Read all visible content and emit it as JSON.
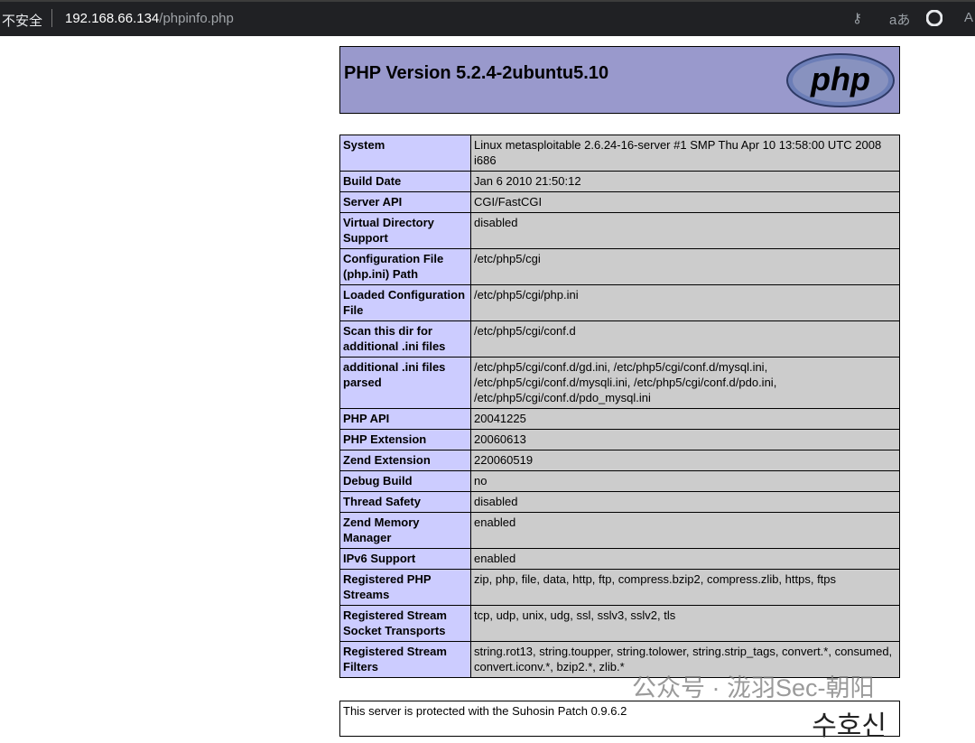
{
  "browser": {
    "security_label": "不安全",
    "url_host": "192.168.66.134",
    "url_path": "/phpinfo.php"
  },
  "header": {
    "title": "PHP Version 5.2.4-2ubuntu5.10",
    "logo_text": "php"
  },
  "rows": [
    {
      "key": "System",
      "value": "Linux metasploitable 2.6.24-16-server #1 SMP Thu Apr 10 13:58:00 UTC 2008 i686"
    },
    {
      "key": "Build Date",
      "value": "Jan 6 2010 21:50:12"
    },
    {
      "key": "Server API",
      "value": "CGI/FastCGI"
    },
    {
      "key": "Virtual Directory Support",
      "value": "disabled"
    },
    {
      "key": "Configuration File (php.ini) Path",
      "value": "/etc/php5/cgi"
    },
    {
      "key": "Loaded Configuration File",
      "value": "/etc/php5/cgi/php.ini"
    },
    {
      "key": "Scan this dir for additional .ini files",
      "value": "/etc/php5/cgi/conf.d"
    },
    {
      "key": "additional .ini files parsed",
      "value": "/etc/php5/cgi/conf.d/gd.ini, /etc/php5/cgi/conf.d/mysql.ini, /etc/php5/cgi/conf.d/mysqli.ini, /etc/php5/cgi/conf.d/pdo.ini, /etc/php5/cgi/conf.d/pdo_mysql.ini"
    },
    {
      "key": "PHP API",
      "value": "20041225"
    },
    {
      "key": "PHP Extension",
      "value": "20060613"
    },
    {
      "key": "Zend Extension",
      "value": "220060519"
    },
    {
      "key": "Debug Build",
      "value": "no"
    },
    {
      "key": "Thread Safety",
      "value": "disabled"
    },
    {
      "key": "Zend Memory Manager",
      "value": "enabled"
    },
    {
      "key": "IPv6 Support",
      "value": "enabled"
    },
    {
      "key": "Registered PHP Streams",
      "value": "zip, php, file, data, http, ftp, compress.bzip2, compress.zlib, https, ftps"
    },
    {
      "key": "Registered Stream Socket Transports",
      "value": "tcp, udp, unix, udg, ssl, sslv3, sslv2, tls"
    },
    {
      "key": "Registered Stream Filters",
      "value": "string.rot13, string.toupper, string.tolower, string.strip_tags, convert.*, consumed, convert.iconv.*, bzip2.*, zlib.*"
    }
  ],
  "footer": {
    "text": "This server is protected with the Suhosin Patch 0.9.6.2",
    "logo_text": "수호신"
  },
  "watermark": "公众号 · 泷羽Sec-朝阳"
}
